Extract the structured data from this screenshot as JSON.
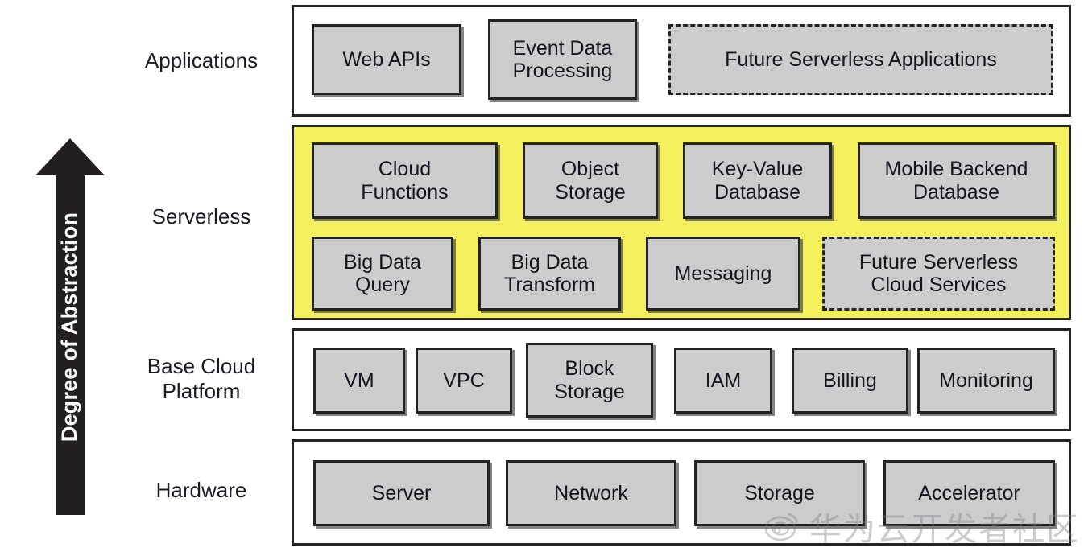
{
  "diagram": {
    "title": "Degree of Abstraction cloud stack",
    "axis_arrow_label": "Degree of Abstraction",
    "colors": {
      "serverless_highlight": "#F4EF5C",
      "box_fill": "#CCCCCC",
      "stroke": "#232323",
      "arrow_fill": "#231F20",
      "page_background": "#FFFFFF"
    },
    "layers": [
      {
        "name": "Applications",
        "highlighted": false,
        "rows": [
          [
            {
              "label": "Web APIs",
              "lines": [
                "Web APIs"
              ],
              "style": "solid"
            },
            {
              "label": "Event Data Processing",
              "lines": [
                "Event Data",
                "Processing"
              ],
              "style": "solid"
            },
            {
              "label": "Future Serverless Applications",
              "lines": [
                "Future Serverless Applications"
              ],
              "style": "dashed"
            }
          ]
        ]
      },
      {
        "name": "Serverless",
        "highlighted": true,
        "rows": [
          [
            {
              "label": "Cloud Functions",
              "lines": [
                "Cloud",
                "Functions"
              ],
              "style": "solid"
            },
            {
              "label": "Object Storage",
              "lines": [
                "Object",
                "Storage"
              ],
              "style": "solid"
            },
            {
              "label": "Key-Value Database",
              "lines": [
                "Key-Value",
                "Database"
              ],
              "style": "solid"
            },
            {
              "label": "Mobile Backend Database",
              "lines": [
                "Mobile Backend",
                "Database"
              ],
              "style": "solid"
            }
          ],
          [
            {
              "label": "Big Data Query",
              "lines": [
                "Big Data",
                "Query"
              ],
              "style": "solid"
            },
            {
              "label": "Big Data Transform",
              "lines": [
                "Big Data",
                "Transform"
              ],
              "style": "solid"
            },
            {
              "label": "Messaging",
              "lines": [
                "Messaging"
              ],
              "style": "solid"
            },
            {
              "label": "Future Serverless Cloud Services",
              "lines": [
                "Future Serverless",
                "Cloud Services"
              ],
              "style": "dashed"
            }
          ]
        ]
      },
      {
        "name": "Base Cloud Platform",
        "name_lines": [
          "Base Cloud",
          "Platform"
        ],
        "highlighted": false,
        "rows": [
          [
            {
              "label": "VM",
              "lines": [
                "VM"
              ],
              "style": "solid"
            },
            {
              "label": "VPC",
              "lines": [
                "VPC"
              ],
              "style": "solid"
            },
            {
              "label": "Block Storage",
              "lines": [
                "Block",
                "Storage"
              ],
              "style": "solid"
            },
            {
              "label": "IAM",
              "lines": [
                "IAM"
              ],
              "style": "solid"
            },
            {
              "label": "Billing",
              "lines": [
                "Billing"
              ],
              "style": "solid"
            },
            {
              "label": "Monitoring",
              "lines": [
                "Monitoring"
              ],
              "style": "solid"
            }
          ]
        ]
      },
      {
        "name": "Hardware",
        "highlighted": false,
        "rows": [
          [
            {
              "label": "Server",
              "lines": [
                "Server"
              ],
              "style": "solid"
            },
            {
              "label": "Network",
              "lines": [
                "Network"
              ],
              "style": "solid"
            },
            {
              "label": "Storage",
              "lines": [
                "Storage"
              ],
              "style": "solid"
            },
            {
              "label": "Accelerator",
              "lines": [
                "Accelerator"
              ],
              "style": "solid"
            }
          ]
        ]
      }
    ]
  },
  "layer_names": {
    "applications": "Applications",
    "serverless": "Serverless",
    "base_line1": "Base Cloud",
    "base_line2": "Platform",
    "hardware": "Hardware"
  },
  "boxes": {
    "web_apis": "Web APIs",
    "event_data_l1": "Event Data",
    "event_data_l2": "Processing",
    "future_apps": "Future Serverless Applications",
    "cloud_functions_l1": "Cloud",
    "cloud_functions_l2": "Functions",
    "object_storage_l1": "Object",
    "object_storage_l2": "Storage",
    "kv_db_l1": "Key-Value",
    "kv_db_l2": "Database",
    "mobile_backend_l1": "Mobile Backend",
    "mobile_backend_l2": "Database",
    "bigdata_query_l1": "Big Data",
    "bigdata_query_l2": "Query",
    "bigdata_transform_l1": "Big Data",
    "bigdata_transform_l2": "Transform",
    "messaging": "Messaging",
    "future_services_l1": "Future Serverless",
    "future_services_l2": "Cloud Services",
    "vm": "VM",
    "vpc": "VPC",
    "block_storage_l1": "Block",
    "block_storage_l2": "Storage",
    "iam": "IAM",
    "billing": "Billing",
    "monitoring": "Monitoring",
    "server": "Server",
    "network": "Network",
    "storage": "Storage",
    "accelerator": "Accelerator"
  },
  "arrow": {
    "label": "Degree of Abstraction"
  },
  "watermark": {
    "text": "华为云开发者社区",
    "logo": "weibo-icon"
  }
}
